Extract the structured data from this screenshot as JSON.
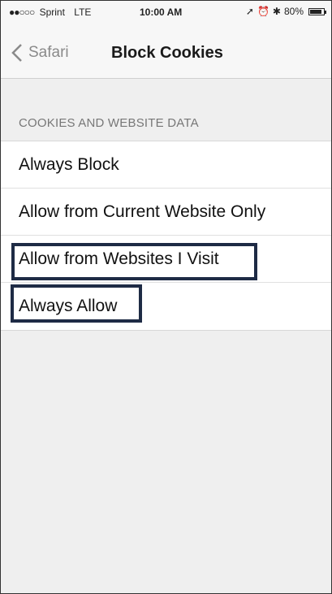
{
  "status_bar": {
    "carrier": "Sprint",
    "network": "LTE",
    "time": "10:00 AM",
    "battery": "80%",
    "signal_dots": "●●○○○"
  },
  "nav": {
    "back_label": "Safari",
    "title": "Block Cookies"
  },
  "section": {
    "header": "COOKIES AND WEBSITE DATA",
    "options": [
      {
        "label": "Always Block"
      },
      {
        "label": "Allow from Current Website Only"
      },
      {
        "label": "Allow from Websites I Visit"
      },
      {
        "label": "Always Allow"
      }
    ]
  },
  "colors": {
    "highlight_border": "#1e2b45",
    "background": "#efefef",
    "back_text": "#8a8a8a"
  }
}
